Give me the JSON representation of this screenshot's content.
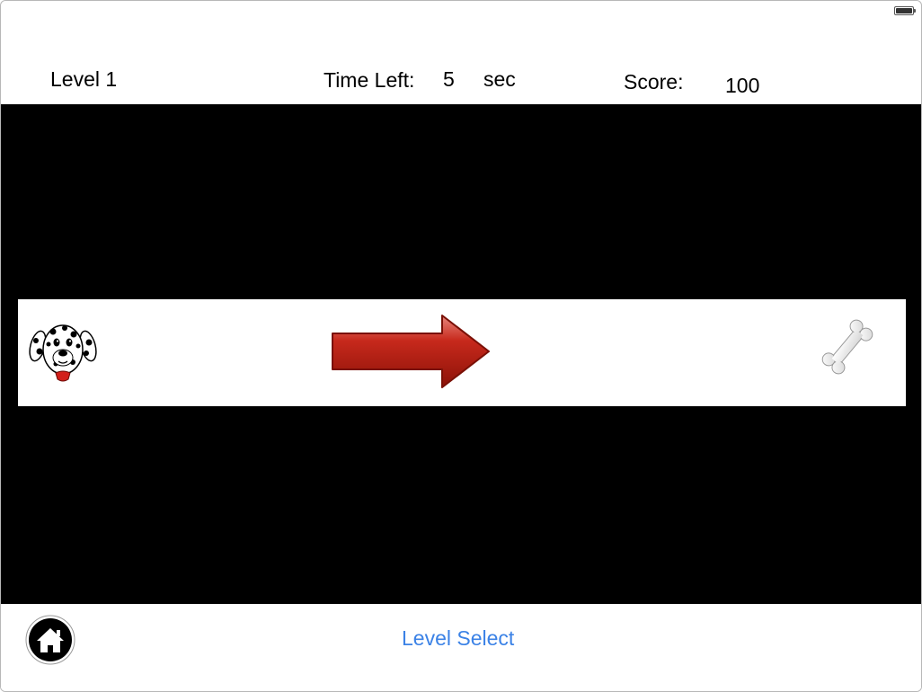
{
  "status_bar": {
    "battery_icon": "battery-full-icon"
  },
  "hud": {
    "level_label": "Level 1",
    "time_left_label": "Time Left:",
    "time_left_value": "5",
    "time_left_unit": "sec",
    "score_label": "Score:",
    "score_value": "100"
  },
  "play_area": {
    "background_color": "#000000",
    "track_color": "#ffffff",
    "sprites": {
      "player": "dalmatian-dog-icon",
      "direction": "red-right-arrow-icon",
      "goal": "bone-icon"
    },
    "arrow_color": "#b81a10"
  },
  "bottom_bar": {
    "home_icon": "home-icon",
    "level_select_label": "Level Select",
    "link_color": "#3b82e6"
  }
}
